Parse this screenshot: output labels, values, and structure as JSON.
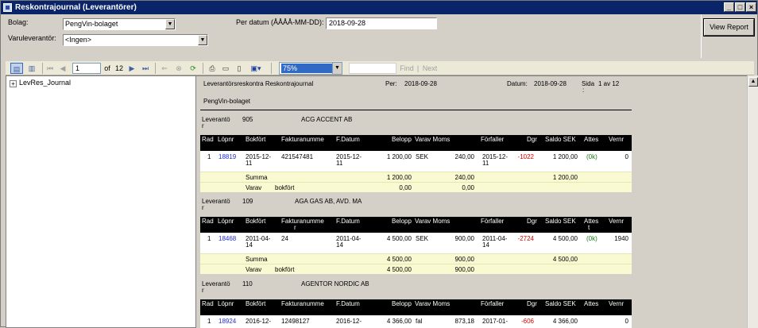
{
  "window": {
    "title": "Reskontrajournal (Leverantörer)"
  },
  "filters": {
    "bolag_label": "Bolag:",
    "bolag_value": "PengVin-bolaget",
    "varuleverantor_label": "Varuleverantör:",
    "varuleverantor_value": "<Ingen>",
    "per_datum_label": "Per datum (ÅÅÅÅ-MM-DD):",
    "per_datum_value": "2018-09-28",
    "view_report_label": "View Report"
  },
  "toolbar": {
    "page_value": "1",
    "of_label": "of",
    "total_pages": "12",
    "zoom_value": "75%",
    "find_label": "Find",
    "separator": "|",
    "next_label": "Next"
  },
  "docmap": {
    "root_label": "LevRes_Journal"
  },
  "icons": [
    "doc-map-icon",
    "params-icon",
    "first-page-icon",
    "prev-page-icon",
    "next-page-icon",
    "last-page-icon",
    "back-icon",
    "stop-icon",
    "refresh-icon",
    "print-icon",
    "print-layout-icon",
    "page-setup-icon",
    "export-icon",
    "scroll-up-icon"
  ],
  "report": {
    "title": "Leverantörsreskontra Reskontrajournal",
    "per_label": "Per:",
    "per_value": "2018-09-28",
    "datum_label": "Datum:",
    "datum_value": "2018-09-28",
    "sida_label": "Sida",
    "sida_value": "1 av 12",
    "sida_colon": ":",
    "company": "PengVin-bolaget",
    "supplier_label": "Leverantö",
    "supplier_label2": "r",
    "columns": {
      "rad": "Rad",
      "lopnr": "Löpnr",
      "bokfort": "Bokfört",
      "fakturanr1": "Fakturanumme",
      "fakturanr2": "r",
      "fdatum": "F.Datum",
      "belopp": "Belopp",
      "varav_moms": "Varav Moms",
      "forfaller": "Förfaller",
      "dgr": "Dgr",
      "saldo": "Saldo SEK",
      "attest": "Attes",
      "attest2": "t",
      "vernr": "Vernr"
    },
    "suppliers": [
      {
        "number": "905",
        "name": "ACG ACCENT AB",
        "row": {
          "rad": "1",
          "lopnr": "18819",
          "bokfort1": "2015-12-",
          "bokfort2": "11",
          "faktura": "421547481",
          "fdatum1": "2015-12-",
          "fdatum2": "11",
          "belopp": "1 200,00",
          "valuta": "SEK",
          "moms": "240,00",
          "forfaller1": "2015-12-",
          "forfaller2": "11",
          "dgr": "-1022",
          "saldo": "1 200,00",
          "attest": "(0k)",
          "vernr": "0"
        },
        "summa": {
          "label": "Summa",
          "belopp": "1 200,00",
          "moms": "240,00",
          "saldo": "1 200,00"
        },
        "varav": {
          "label1": "Varav",
          "label2": "bokfört",
          "belopp": "0,00",
          "moms": "0,00"
        }
      },
      {
        "number": "109",
        "name": "AGA GAS AB, AVD. MA",
        "row": {
          "rad": "1",
          "lopnr": "18468",
          "bokfort1": "2011-04-",
          "bokfort2": "14",
          "faktura": "24",
          "fdatum1": "2011-04-",
          "fdatum2": "14",
          "belopp": "4 500,00",
          "valuta": "SEK",
          "moms": "900,00",
          "forfaller1": "2011-04-",
          "forfaller2": "14",
          "dgr": "-2724",
          "saldo": "4 500,00",
          "attest": "(0k)",
          "vernr": "1940"
        },
        "summa": {
          "label": "Summa",
          "belopp": "4 500,00",
          "moms": "900,00",
          "saldo": "4 500,00"
        },
        "varav": {
          "label1": "Varav",
          "label2": "bokfört",
          "belopp": "4 500,00",
          "moms": "900,00"
        }
      },
      {
        "number": "110",
        "name": "AGENTOR NORDIC AB",
        "row": {
          "rad": "1",
          "lopnr": "18924",
          "bokfort1": "2016-12-",
          "faktura": "12498127",
          "fdatum1": "2016-12-",
          "belopp": "4 366,00",
          "valuta": "fal",
          "moms": "873,18",
          "forfaller1": "2017-01-",
          "dgr": "-606",
          "saldo": "4 366,00",
          "vernr": "0"
        }
      }
    ]
  }
}
